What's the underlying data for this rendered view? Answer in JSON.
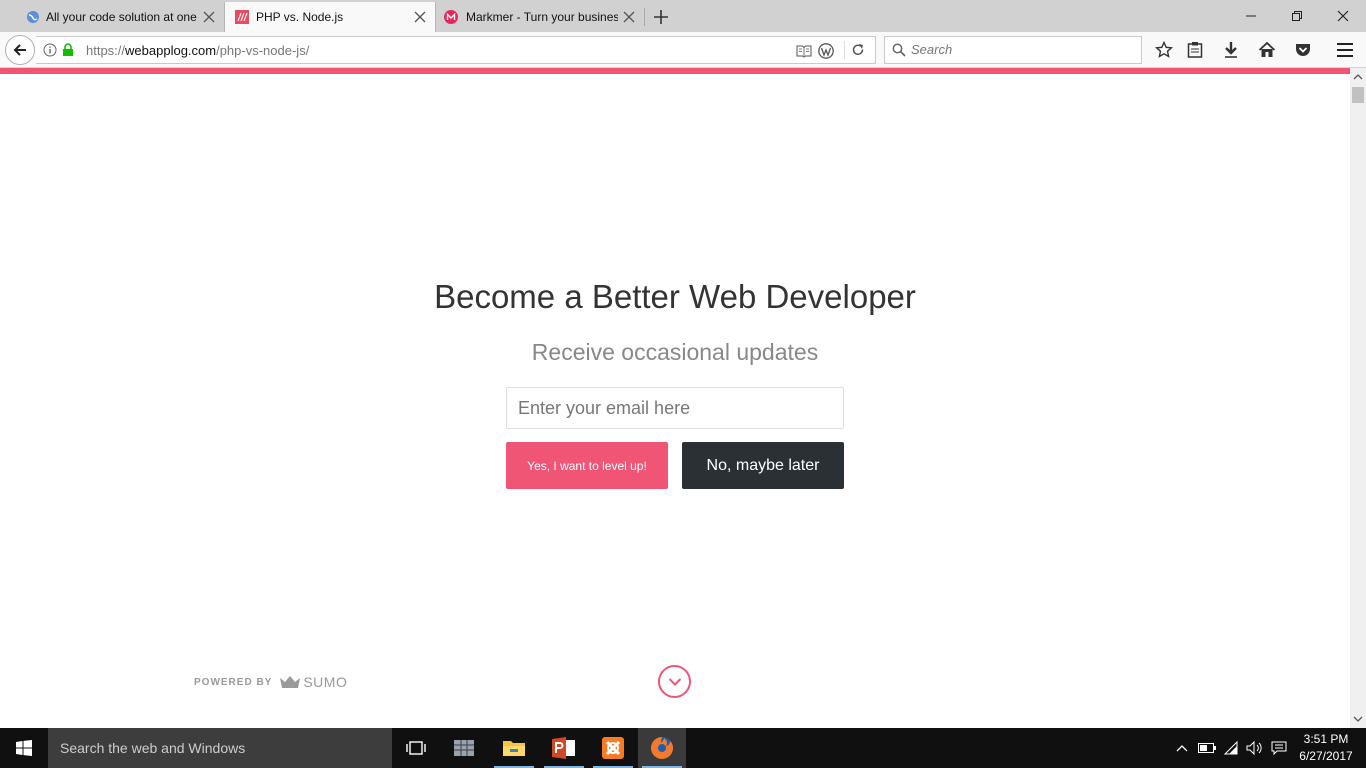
{
  "tabs": [
    {
      "title": "All your code solution at one place"
    },
    {
      "title": "PHP vs. Node.js"
    },
    {
      "title": "Markmer - Turn your business"
    }
  ],
  "address": {
    "prefix": "https://",
    "domain": "webapplog.com",
    "path": "/php-vs-node-js/"
  },
  "search": {
    "placeholder": "Search"
  },
  "optin": {
    "headline": "Become a Better Web Developer",
    "subheadline": "Receive occasional updates",
    "email_placeholder": "Enter your email here",
    "accept_label": "Yes, I want to level up!",
    "decline_label": "No, maybe later"
  },
  "powered": {
    "prefix": "POWERED BY",
    "brand": "SUMO"
  },
  "taskbar": {
    "search_text": "Search the web and Windows",
    "time": "3:51 PM",
    "date": "6/27/2017"
  },
  "colors": {
    "accent": "#f05576",
    "dark_button": "#2b3035"
  }
}
